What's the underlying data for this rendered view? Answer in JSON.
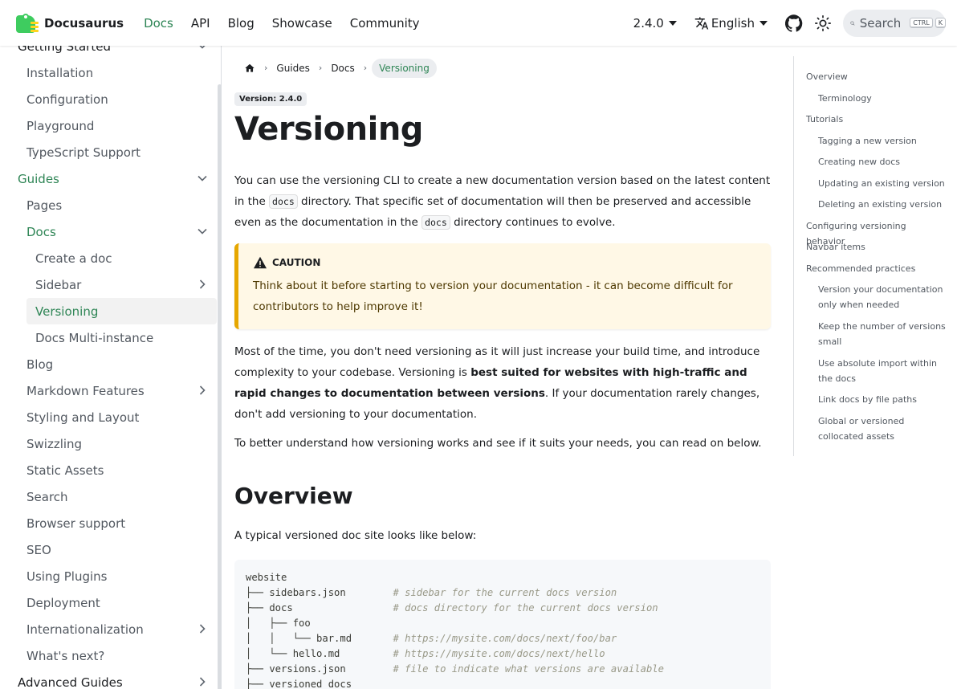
{
  "navbar": {
    "brand": "Docusaurus",
    "links": [
      "Docs",
      "API",
      "Blog",
      "Showcase",
      "Community"
    ],
    "version": "2.4.0",
    "language": "English",
    "search_placeholder": "Search",
    "keys": [
      "CTRL",
      "K"
    ],
    "accent": "#2e8555"
  },
  "sidebar": {
    "items": [
      {
        "label": "Getting Started",
        "level": 0,
        "chevron": "down"
      },
      {
        "label": "Installation",
        "level": 1
      },
      {
        "label": "Configuration",
        "level": 1
      },
      {
        "label": "Playground",
        "level": 1
      },
      {
        "label": "TypeScript Support",
        "level": 1
      },
      {
        "label": "Guides",
        "level": 0,
        "chevron": "down",
        "active": true
      },
      {
        "label": "Pages",
        "level": 1
      },
      {
        "label": "Docs",
        "level": 1,
        "chevron": "down",
        "active": true
      },
      {
        "label": "Create a doc",
        "level": 2
      },
      {
        "label": "Sidebar",
        "level": 2,
        "chevron": "right"
      },
      {
        "label": "Versioning",
        "level": 2,
        "current": true
      },
      {
        "label": "Docs Multi-instance",
        "level": 2
      },
      {
        "label": "Blog",
        "level": 1
      },
      {
        "label": "Markdown Features",
        "level": 1,
        "chevron": "right"
      },
      {
        "label": "Styling and Layout",
        "level": 1
      },
      {
        "label": "Swizzling",
        "level": 1
      },
      {
        "label": "Static Assets",
        "level": 1
      },
      {
        "label": "Search",
        "level": 1
      },
      {
        "label": "Browser support",
        "level": 1
      },
      {
        "label": "SEO",
        "level": 1
      },
      {
        "label": "Using Plugins",
        "level": 1
      },
      {
        "label": "Deployment",
        "level": 1
      },
      {
        "label": "Internationalization",
        "level": 1,
        "chevron": "right"
      },
      {
        "label": "What's next?",
        "level": 1
      },
      {
        "label": "Advanced Guides",
        "level": 0,
        "chevron": "right"
      }
    ]
  },
  "breadcrumb": {
    "items": [
      "Guides",
      "Docs"
    ],
    "current": "Versioning"
  },
  "doc": {
    "version_badge": "Version: 2.4.0",
    "title": "Versioning",
    "intro_a": "You can use the versioning CLI to create a new documentation version based on the latest content in the ",
    "intro_code1": "docs",
    "intro_b": " directory. That specific set of documentation will then be preserved and accessible even as the documentation in the ",
    "intro_code2": "docs",
    "intro_c": " directory continues to evolve.",
    "caution_title": "CAUTION",
    "caution_text": "Think about it before starting to version your documentation - it can become difficult for contributors to help improve it!",
    "p2_a": "Most of the time, you don't need versioning as it will just increase your build time, and introduce complexity to your codebase. Versioning is ",
    "p2_bold": "best suited for websites with high-traffic and rapid changes to documentation between versions",
    "p2_c": ". If your documentation rarely changes, don't add versioning to your documentation.",
    "p3": "To better understand how versioning works and see if it suits your needs, you can read on below.",
    "h2": "Overview",
    "p4": "A typical versioned doc site looks like below:",
    "code_lines": [
      {
        "code": "website",
        "comment": ""
      },
      {
        "code": "├── sidebars.json        ",
        "comment": "# sidebar for the current docs version"
      },
      {
        "code": "├── docs                 ",
        "comment": "# docs directory for the current docs version"
      },
      {
        "code": "│   ├── foo",
        "comment": ""
      },
      {
        "code": "│   │   └── bar.md       ",
        "comment": "# https://mysite.com/docs/next/foo/bar"
      },
      {
        "code": "│   └── hello.md         ",
        "comment": "# https://mysite.com/docs/next/hello"
      },
      {
        "code": "├── versions.json        ",
        "comment": "# file to indicate what versions are available"
      },
      {
        "code": "├── versioned_docs",
        "comment": ""
      }
    ]
  },
  "toc": {
    "items": [
      {
        "label": "Overview",
        "level": 0
      },
      {
        "label": "Terminology",
        "level": 1
      },
      {
        "label": "Tutorials",
        "level": 0
      },
      {
        "label": "Tagging a new version",
        "level": 1
      },
      {
        "label": "Creating new docs",
        "level": 1
      },
      {
        "label": "Updating an existing version",
        "level": 1
      },
      {
        "label": "Deleting an existing version",
        "level": 1
      },
      {
        "label": "Configuring versioning behavior",
        "level": 0
      },
      {
        "label": "Navbar items",
        "level": 0
      },
      {
        "label": "Recommended practices",
        "level": 0
      },
      {
        "label": "Version your documentation only when needed",
        "level": 1
      },
      {
        "label": "Keep the number of versions small",
        "level": 1
      },
      {
        "label": "Use absolute import within the docs",
        "level": 1
      },
      {
        "label": "Link docs by file paths",
        "level": 1
      },
      {
        "label": "Global or versioned collocated assets",
        "level": 1
      }
    ]
  }
}
